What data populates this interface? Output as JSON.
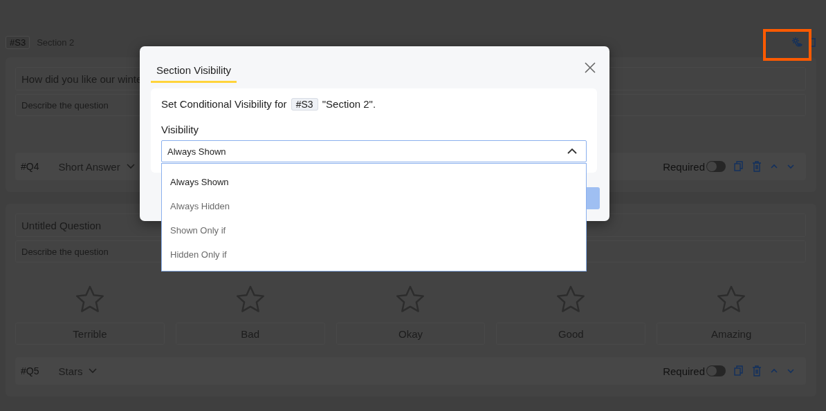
{
  "section": {
    "tag": "#S3",
    "title": "Section 2"
  },
  "questions": [
    {
      "kind": "short_answer",
      "title": "How did you like our winte",
      "description_placeholder": "Describe the question",
      "number": "#Q4",
      "type": "Short Answer",
      "required_label": "Required",
      "required": false
    },
    {
      "kind": "stars",
      "title": "Untitled Question",
      "description_placeholder": "Describe the question",
      "options": [
        "Terrible",
        "Bad",
        "Okay",
        "Good",
        "Amazing"
      ],
      "number": "#Q5",
      "type": "Stars",
      "required_label": "Required",
      "required": false
    }
  ],
  "dialog": {
    "tab": {
      "label": "Section Visibility",
      "selected": true
    },
    "message": {
      "prefix": "Set Conditional Visibility for",
      "tag": "#S3",
      "suffix": "\"Section 2\"."
    },
    "field_label": "Visibility",
    "select": {
      "value": "Always Shown",
      "expanded": true
    },
    "options": [
      {
        "label": "Always Shown",
        "selected": true
      },
      {
        "label": "Always Hidden",
        "selected": false
      },
      {
        "label": "Shown Only if",
        "selected": false
      },
      {
        "label": "Hidden Only if",
        "selected": false
      }
    ]
  }
}
